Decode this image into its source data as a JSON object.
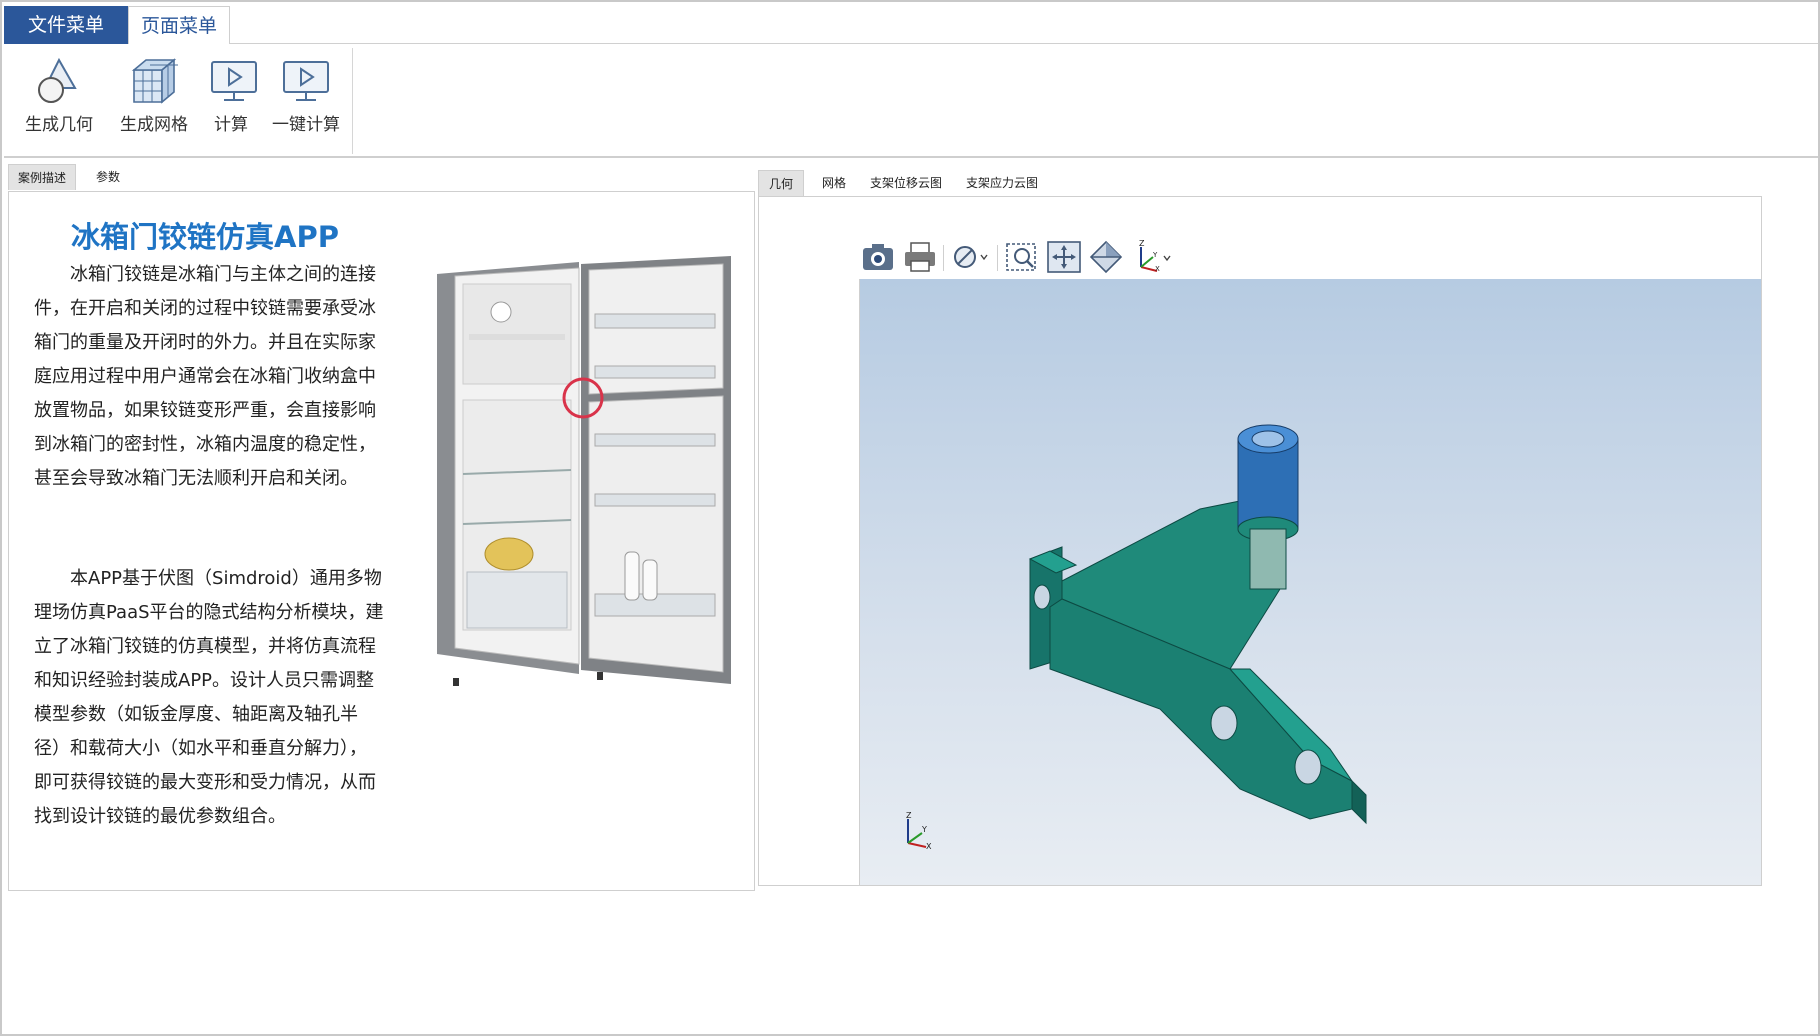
{
  "menu": {
    "file_label": "文件菜单",
    "page_label": "页面菜单"
  },
  "ribbon": {
    "buttons": [
      {
        "label": "生成几何",
        "icon": "geometry-icon"
      },
      {
        "label": "生成网格",
        "icon": "mesh-icon"
      },
      {
        "label": "计算",
        "icon": "compute-icon"
      },
      {
        "label": "一键计算",
        "icon": "one-click-compute-icon"
      }
    ]
  },
  "left": {
    "tabs": [
      "案例描述",
      "参数"
    ],
    "title": "冰箱门铰链仿真APP",
    "para1": "冰箱门铰链是冰箱门与主体之间的连接件，在开启和关闭的过程中铰链需要承受冰箱门的重量及开闭时的外力。并且在实际家庭应用过程中用户通常会在冰箱门收纳盒中放置物品，如果铰链变形严重，会直接影响到冰箱门的密封性，冰箱内温度的稳定性，甚至会导致冰箱门无法顺利开启和关闭。",
    "para2": "本APP基于伏图（Simdroid）通用多物理场仿真PaaS平台的隐式结构分析模块，建立了冰箱门铰链的仿真模型，并将仿真流程和知识经验封装成APP。设计人员只需调整模型参数（如钣金厚度、轴距离及轴孔半径）和载荷大小（如水平和垂直分解力），即可获得铰链的最大变形和受力情况，从而找到设计铰链的最优参数组合。"
  },
  "right": {
    "tabs": [
      "几何",
      "网格",
      "支架位移云图",
      "支架应力云图"
    ],
    "toolbar": [
      "camera-icon",
      "print-icon",
      "visibility-icon",
      "zoom-box-icon",
      "fit-view-icon",
      "iso-view-icon",
      "axis-icon"
    ],
    "triad": {
      "x": "X",
      "y": "Y",
      "z": "Z"
    }
  },
  "colors": {
    "accent": "#2b579a",
    "title": "#1f74c4",
    "model_teal": "#1f8a7a",
    "model_blue": "#2d6fb5"
  }
}
